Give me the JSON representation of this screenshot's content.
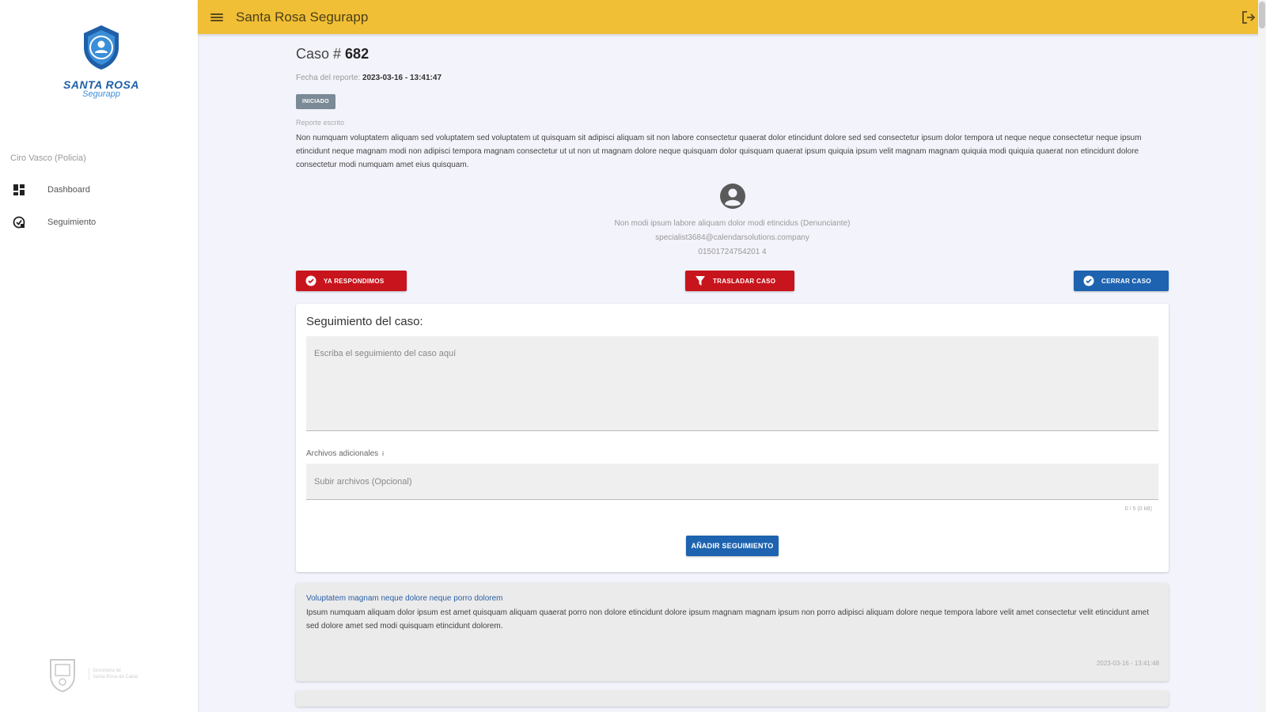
{
  "app": {
    "title": "Santa Rosa Segurapp",
    "brand_color": "#f1bf35",
    "primary_color": "#1d63b0",
    "danger_color": "#c8141c"
  },
  "logo": {
    "name": "SANTA ROSA",
    "sub": "Segurapp"
  },
  "sidebar": {
    "user_label": "Ciro Vasco (Policia)",
    "items": [
      {
        "label": "Dashboard",
        "icon": "dashboard-icon"
      },
      {
        "label": "Seguimiento",
        "icon": "seguimiento-icon"
      }
    ],
    "footer_text_1": "Secretaría de",
    "footer_text_2": "Santa Rosa de Cabal"
  },
  "case": {
    "title_prefix": "Caso # ",
    "number": "682",
    "date_label": "Fecha del reporte: ",
    "date_value": "2023-03-16 - 13:41:47",
    "status": "INICIADO",
    "report_label": "Reporte escrito",
    "report_text": "Non numquam voluptatem aliquam sed voluptatem sed voluptatem ut quisquam sit adipisci aliquam sit non labore consectetur quaerat dolor etincidunt dolore sed sed consectetur ipsum dolor tempora ut neque neque consectetur neque ipsum etincidunt neque magnam modi non adipisci tempora magnam consectetur ut ut non ut magnam dolore neque quisquam dolor quisquam quaerat ipsum quiquia ipsum velit magnam magnam quiquia modi quiquia quaerat non etincidunt dolore consectetur modi numquam amet eius quisquam.",
    "reporter_name": "Non modi ipsum labore aliquam dolor modi etincidus (Denunciante)",
    "reporter_email": "specialist3684@calendarsolutions.company",
    "reporter_phone": "01501724754201 4"
  },
  "actions": {
    "respond": "YA RESPONDIMOS",
    "transfer": "TRASLADAR CASO",
    "close": "CERRAR CASO"
  },
  "followup_form": {
    "title": "Seguimiento del caso:",
    "textarea_placeholder": "Escriba el seguimiento del caso aquí",
    "files_label": "Archivos adicionales",
    "files_info": "i",
    "files_placeholder": "Subir archivos (Opcional)",
    "counter": "0 / 5 (0 kB)",
    "submit": "AÑADIR SEGUIMIENTO"
  },
  "followups": [
    {
      "title": "Voluptatem magnam neque dolore neque porro dolorem",
      "text": "Ipsum numquam aliquam dolor ipsum est amet quisquam aliquam quaerat porro non dolore etincidunt dolore ipsum magnam magnam ipsum non porro adipisci aliquam dolore neque tempora labore velit amet consectetur velit etincidunt amet sed dolore amet sed modi quisquam etincidunt dolorem.",
      "date": "2023-03-16 - 13:41:48"
    }
  ]
}
